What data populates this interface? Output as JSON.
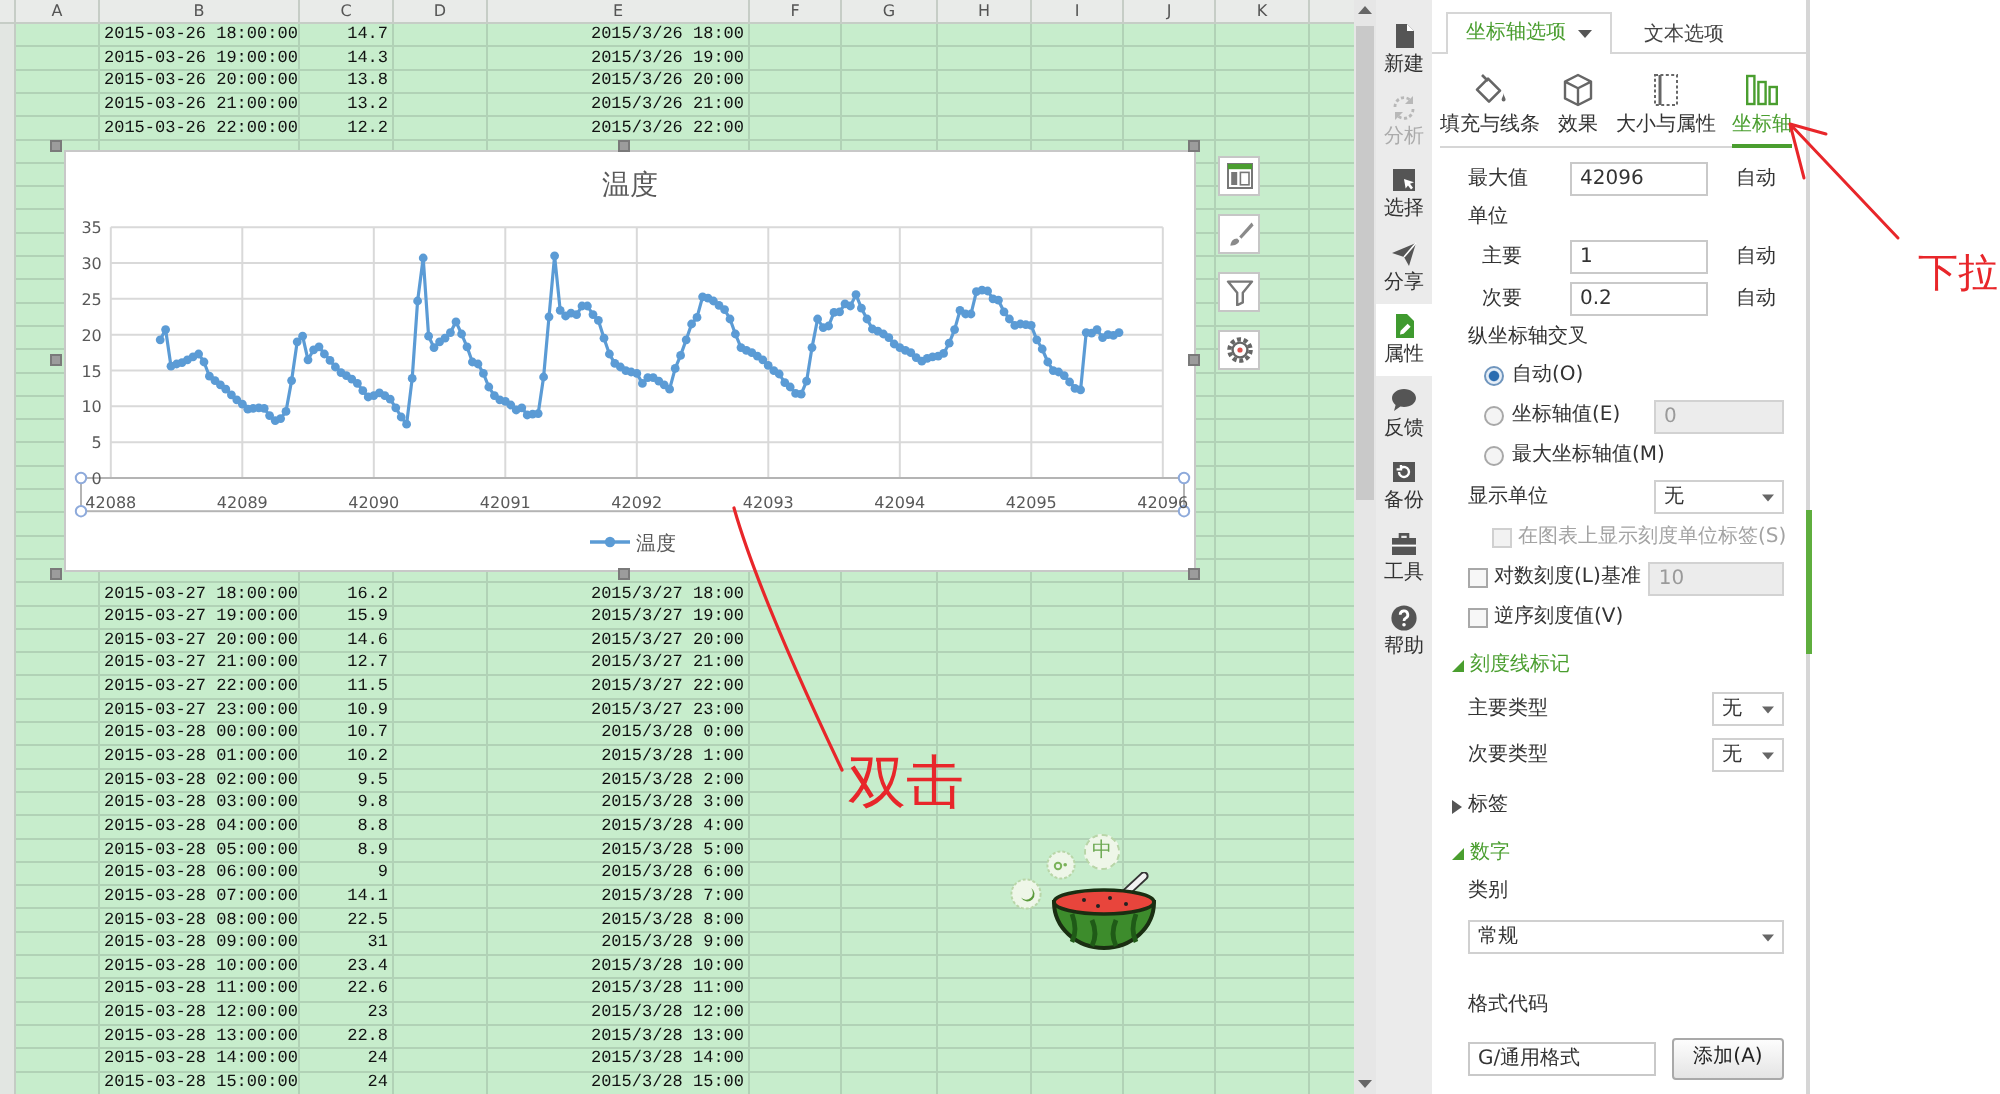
{
  "sheet": {
    "column_headers": [
      "A",
      "B",
      "C",
      "D",
      "E",
      "F",
      "G",
      "H",
      "I",
      "J",
      "K"
    ],
    "rows_top": [
      {
        "column_b": "2015-03-26 18:00:00",
        "column_c": "14.7",
        "column_e": "2015/3/26 18:00"
      },
      {
        "column_b": "2015-03-26 19:00:00",
        "column_c": "14.3",
        "column_e": "2015/3/26 19:00"
      },
      {
        "column_b": "2015-03-26 20:00:00",
        "column_c": "13.8",
        "column_e": "2015/3/26 20:00"
      },
      {
        "column_b": "2015-03-26 21:00:00",
        "column_c": "13.2",
        "column_e": "2015/3/26 21:00"
      },
      {
        "column_b": "2015-03-26 22:00:00",
        "column_c": "12.2",
        "column_e": "2015/3/26 22:00"
      }
    ],
    "rows_bottom": [
      {
        "column_b": "2015-03-27 18:00:00",
        "column_c": "16.2",
        "column_e": "2015/3/27 18:00"
      },
      {
        "column_b": "2015-03-27 19:00:00",
        "column_c": "15.9",
        "column_e": "2015/3/27 19:00"
      },
      {
        "column_b": "2015-03-27 20:00:00",
        "column_c": "14.6",
        "column_e": "2015/3/27 20:00"
      },
      {
        "column_b": "2015-03-27 21:00:00",
        "column_c": "12.7",
        "column_e": "2015/3/27 21:00"
      },
      {
        "column_b": "2015-03-27 22:00:00",
        "column_c": "11.5",
        "column_e": "2015/3/27 22:00"
      },
      {
        "column_b": "2015-03-27 23:00:00",
        "column_c": "10.9",
        "column_e": "2015/3/27 23:00"
      },
      {
        "column_b": "2015-03-28 00:00:00",
        "column_c": "10.7",
        "column_e": "2015/3/28 0:00"
      },
      {
        "column_b": "2015-03-28 01:00:00",
        "column_c": "10.2",
        "column_e": "2015/3/28 1:00"
      },
      {
        "column_b": "2015-03-28 02:00:00",
        "column_c": "9.5",
        "column_e": "2015/3/28 2:00"
      },
      {
        "column_b": "2015-03-28 03:00:00",
        "column_c": "9.8",
        "column_e": "2015/3/28 3:00"
      },
      {
        "column_b": "2015-03-28 04:00:00",
        "column_c": "8.8",
        "column_e": "2015/3/28 4:00"
      },
      {
        "column_b": "2015-03-28 05:00:00",
        "column_c": "8.9",
        "column_e": "2015/3/28 5:00"
      },
      {
        "column_b": "2015-03-28 06:00:00",
        "column_c": "9",
        "column_e": "2015/3/28 6:00"
      },
      {
        "column_b": "2015-03-28 07:00:00",
        "column_c": "14.1",
        "column_e": "2015/3/28 7:00"
      },
      {
        "column_b": "2015-03-28 08:00:00",
        "column_c": "22.5",
        "column_e": "2015/3/28 8:00"
      },
      {
        "column_b": "2015-03-28 09:00:00",
        "column_c": "31",
        "column_e": "2015/3/28 9:00"
      },
      {
        "column_b": "2015-03-28 10:00:00",
        "column_c": "23.4",
        "column_e": "2015/3/28 10:00"
      },
      {
        "column_b": "2015-03-28 11:00:00",
        "column_c": "22.6",
        "column_e": "2015/3/28 11:00"
      },
      {
        "column_b": "2015-03-28 12:00:00",
        "column_c": "23",
        "column_e": "2015/3/28 12:00"
      },
      {
        "column_b": "2015-03-28 13:00:00",
        "column_c": "22.8",
        "column_e": "2015/3/28 13:00"
      },
      {
        "column_b": "2015-03-28 14:00:00",
        "column_c": "24",
        "column_e": "2015/3/28 14:00"
      },
      {
        "column_b": "2015-03-28 15:00:00",
        "column_c": "24",
        "column_e": "2015/3/28 15:00"
      }
    ]
  },
  "chart": {
    "selected": true,
    "x_axis_selected": true,
    "chart_data": {
      "type": "line",
      "title": "温度",
      "grid": true,
      "x": [
        42088.375,
        42088.417,
        42088.458,
        42088.5,
        42088.542,
        42088.583,
        42088.625,
        42088.667,
        42088.708,
        42088.75,
        42088.792,
        42088.833,
        42088.875,
        42088.917,
        42088.958,
        42089,
        42089.042,
        42089.083,
        42089.125,
        42089.167,
        42089.208,
        42089.25,
        42089.292,
        42089.333,
        42089.375,
        42089.417,
        42089.458,
        42089.5,
        42089.542,
        42089.583,
        42089.625,
        42089.667,
        42089.708,
        42089.75,
        42089.792,
        42089.833,
        42089.875,
        42089.917,
        42089.958,
        42090,
        42090.042,
        42090.083,
        42090.125,
        42090.167,
        42090.208,
        42090.25,
        42090.292,
        42090.333,
        42090.375,
        42090.417,
        42090.458,
        42090.5,
        42090.542,
        42090.583,
        42090.625,
        42090.667,
        42090.708,
        42090.75,
        42090.792,
        42090.833,
        42090.875,
        42090.917,
        42090.958,
        42091,
        42091.042,
        42091.083,
        42091.125,
        42091.167,
        42091.208,
        42091.25,
        42091.292,
        42091.333,
        42091.375,
        42091.417,
        42091.458,
        42091.5,
        42091.542,
        42091.583,
        42091.625,
        42091.667,
        42091.708,
        42091.75,
        42091.792,
        42091.833,
        42091.875,
        42091.917,
        42091.958,
        42092,
        42092.042,
        42092.083,
        42092.125,
        42092.167,
        42092.208,
        42092.25,
        42092.292,
        42092.333,
        42092.375,
        42092.417,
        42092.458,
        42092.5,
        42092.542,
        42092.583,
        42092.625,
        42092.667,
        42092.708,
        42092.75,
        42092.792,
        42092.833,
        42092.875,
        42092.917,
        42092.958,
        42093,
        42093.042,
        42093.083,
        42093.125,
        42093.167,
        42093.208,
        42093.25,
        42093.292,
        42093.333,
        42093.375,
        42093.417,
        42093.458,
        42093.5,
        42093.542,
        42093.583,
        42093.625,
        42093.667,
        42093.708,
        42093.75,
        42093.792,
        42093.833,
        42093.875,
        42093.917,
        42093.958,
        42094,
        42094.042,
        42094.083,
        42094.125,
        42094.167,
        42094.208,
        42094.25,
        42094.292,
        42094.333,
        42094.375,
        42094.417,
        42094.458,
        42094.5,
        42094.542,
        42094.583,
        42094.625,
        42094.667,
        42094.708,
        42094.75,
        42094.792,
        42094.833,
        42094.875,
        42094.917,
        42094.958,
        42095,
        42095.042,
        42095.083,
        42095.125,
        42095.167,
        42095.208,
        42095.25,
        42095.292,
        42095.333,
        42095.375,
        42095.417,
        42095.458,
        42095.5,
        42095.542,
        42095.583,
        42095.625,
        42095.667
      ],
      "series": [
        {
          "name": "温度",
          "color": "#5b9bd5",
          "marker": "circle",
          "values": [
            19.3,
            20.7,
            15.6,
            15.9,
            16.1,
            16.5,
            16.9,
            17.3,
            16.2,
            14.2,
            13.6,
            13.0,
            12.4,
            11.6,
            10.9,
            10.3,
            9.6,
            9.7,
            9.8,
            9.7,
            8.7,
            8.0,
            8.3,
            9.3,
            13.6,
            19.0,
            19.8,
            16.5,
            17.9,
            18.3,
            17.3,
            16.4,
            15.5,
            14.7,
            14.3,
            13.8,
            13.2,
            12.2,
            11.3,
            11.5,
            11.9,
            11.5,
            11.0,
            9.8,
            8.5,
            7.5,
            13.9,
            24.7,
            30.7,
            19.8,
            18.2,
            19.0,
            19.5,
            20.3,
            21.8,
            20.1,
            18.3,
            16.2,
            15.9,
            14.6,
            12.7,
            11.5,
            10.9,
            10.7,
            10.2,
            9.5,
            9.8,
            8.8,
            8.9,
            9,
            14.1,
            22.5,
            31,
            23.4,
            22.6,
            23,
            22.8,
            24,
            24,
            22.8,
            22.0,
            19.5,
            17.3,
            16.0,
            15.5,
            15.0,
            14.8,
            14.6,
            13.2,
            14.0,
            14.0,
            13.5,
            13.0,
            12.4,
            15.3,
            17.1,
            19.3,
            21.5,
            22.4,
            25.3,
            25.1,
            24.7,
            24.1,
            23.5,
            22.2,
            20.1,
            18.2,
            17.8,
            17.5,
            17.0,
            16.5,
            15.7,
            15.0,
            14.5,
            13.3,
            12.7,
            11.8,
            11.7,
            13.5,
            18.2,
            22.2,
            21.0,
            21.2,
            23.1,
            23.2,
            24.3,
            24.0,
            25.6,
            23.7,
            22.2,
            20.8,
            20.5,
            20.1,
            19.6,
            18.7,
            18.2,
            17.8,
            17.5,
            16.8,
            16.3,
            16.7,
            16.9,
            17.0,
            17.4,
            18.8,
            20.7,
            23.4,
            22.9,
            22.9,
            26.0,
            26.2,
            26.1,
            25.0,
            24.8,
            23.2,
            22.2,
            21.3,
            21.5,
            21.4,
            21.3,
            19.3,
            18.0,
            16.2,
            15.0,
            14.8,
            14.3,
            13.4,
            12.5,
            12.3,
            20.3,
            20.2,
            20.7,
            19.6,
            20.0,
            19.9,
            20.3
          ]
        }
      ],
      "xlim": [
        42088,
        42096
      ],
      "ylim": [
        0,
        35
      ],
      "xticks": [
        42088,
        42089,
        42090,
        42091,
        42092,
        42093,
        42094,
        42095,
        42096
      ],
      "yticks": [
        0,
        5,
        10,
        15,
        20,
        25,
        30,
        35
      ]
    }
  },
  "sidebar": {
    "items": [
      {
        "label": "新建",
        "selected": false,
        "disabled": false
      },
      {
        "label": "分析",
        "selected": false,
        "disabled": true
      },
      {
        "label": "选择",
        "selected": false,
        "disabled": false
      },
      {
        "label": "分享",
        "selected": false,
        "disabled": false
      },
      {
        "label": "属性",
        "selected": true,
        "disabled": false
      },
      {
        "label": "反馈",
        "selected": false,
        "disabled": false
      },
      {
        "label": "备份",
        "selected": false,
        "disabled": false
      },
      {
        "label": "工具",
        "selected": false,
        "disabled": false
      },
      {
        "label": "帮助",
        "selected": false,
        "disabled": false
      }
    ]
  },
  "panel": {
    "tabs": [
      {
        "label": "坐标轴选项",
        "selected": true,
        "dropdown": true
      },
      {
        "label": "文本选项",
        "selected": false,
        "dropdown": false
      }
    ],
    "icon_tabs": [
      {
        "label": "填充与线条",
        "selected": false
      },
      {
        "label": "效果",
        "selected": false
      },
      {
        "label": "大小与属性",
        "selected": false
      },
      {
        "label": "坐标轴",
        "selected": true
      }
    ],
    "options": [
      {
        "kind": "input",
        "label": "最大值",
        "value": "42096",
        "note": "自动"
      },
      {
        "kind": "heading",
        "label": "单位",
        "children": [
          {
            "kind": "input",
            "label": "主要",
            "value": "1",
            "note": "自动"
          },
          {
            "kind": "input",
            "label": "次要",
            "value": "0.2",
            "note": "自动"
          }
        ]
      },
      {
        "kind": "heading",
        "label": "纵坐标轴交叉",
        "children": [
          {
            "kind": "radio",
            "label": "自动(O)",
            "selected": true
          },
          {
            "kind": "radio",
            "label": "坐标轴值(E)",
            "selected": false,
            "value": "0",
            "field_disabled": true
          },
          {
            "kind": "radio",
            "label": "最大坐标轴值(M)",
            "selected": false
          }
        ]
      },
      {
        "kind": "select",
        "label": "显示单位",
        "value": "无",
        "children": [
          {
            "kind": "checkbox",
            "label": "在图表上显示刻度单位标签(S)",
            "checked": false,
            "disabled": true
          }
        ]
      },
      {
        "kind": "checkbox",
        "label": "对数刻度(L)",
        "checked": false,
        "disabled": false,
        "field_label": "基准",
        "value": "10",
        "field_disabled": true
      },
      {
        "kind": "checkbox",
        "label": "逆序刻度值(V)",
        "checked": false,
        "disabled": false
      }
    ],
    "sections": [
      {
        "title": "刻度线标记",
        "expanded": true,
        "options": [
          {
            "kind": "select",
            "label": "主要类型",
            "value": "无"
          },
          {
            "kind": "select",
            "label": "次要类型",
            "value": "无"
          }
        ]
      },
      {
        "title": "标签",
        "expanded": false
      },
      {
        "title": "数字",
        "expanded": true,
        "options": [
          {
            "kind": "select_block",
            "label": "类别",
            "value": "常规"
          },
          {
            "kind": "input_button",
            "label": "格式代码",
            "value": "G/通用格式",
            "button": "添加(A)"
          }
        ]
      }
    ]
  },
  "annotations": [
    {
      "text": "双击"
    },
    {
      "text": "下拉"
    }
  ],
  "sticker": {
    "bubble_text": "中"
  }
}
